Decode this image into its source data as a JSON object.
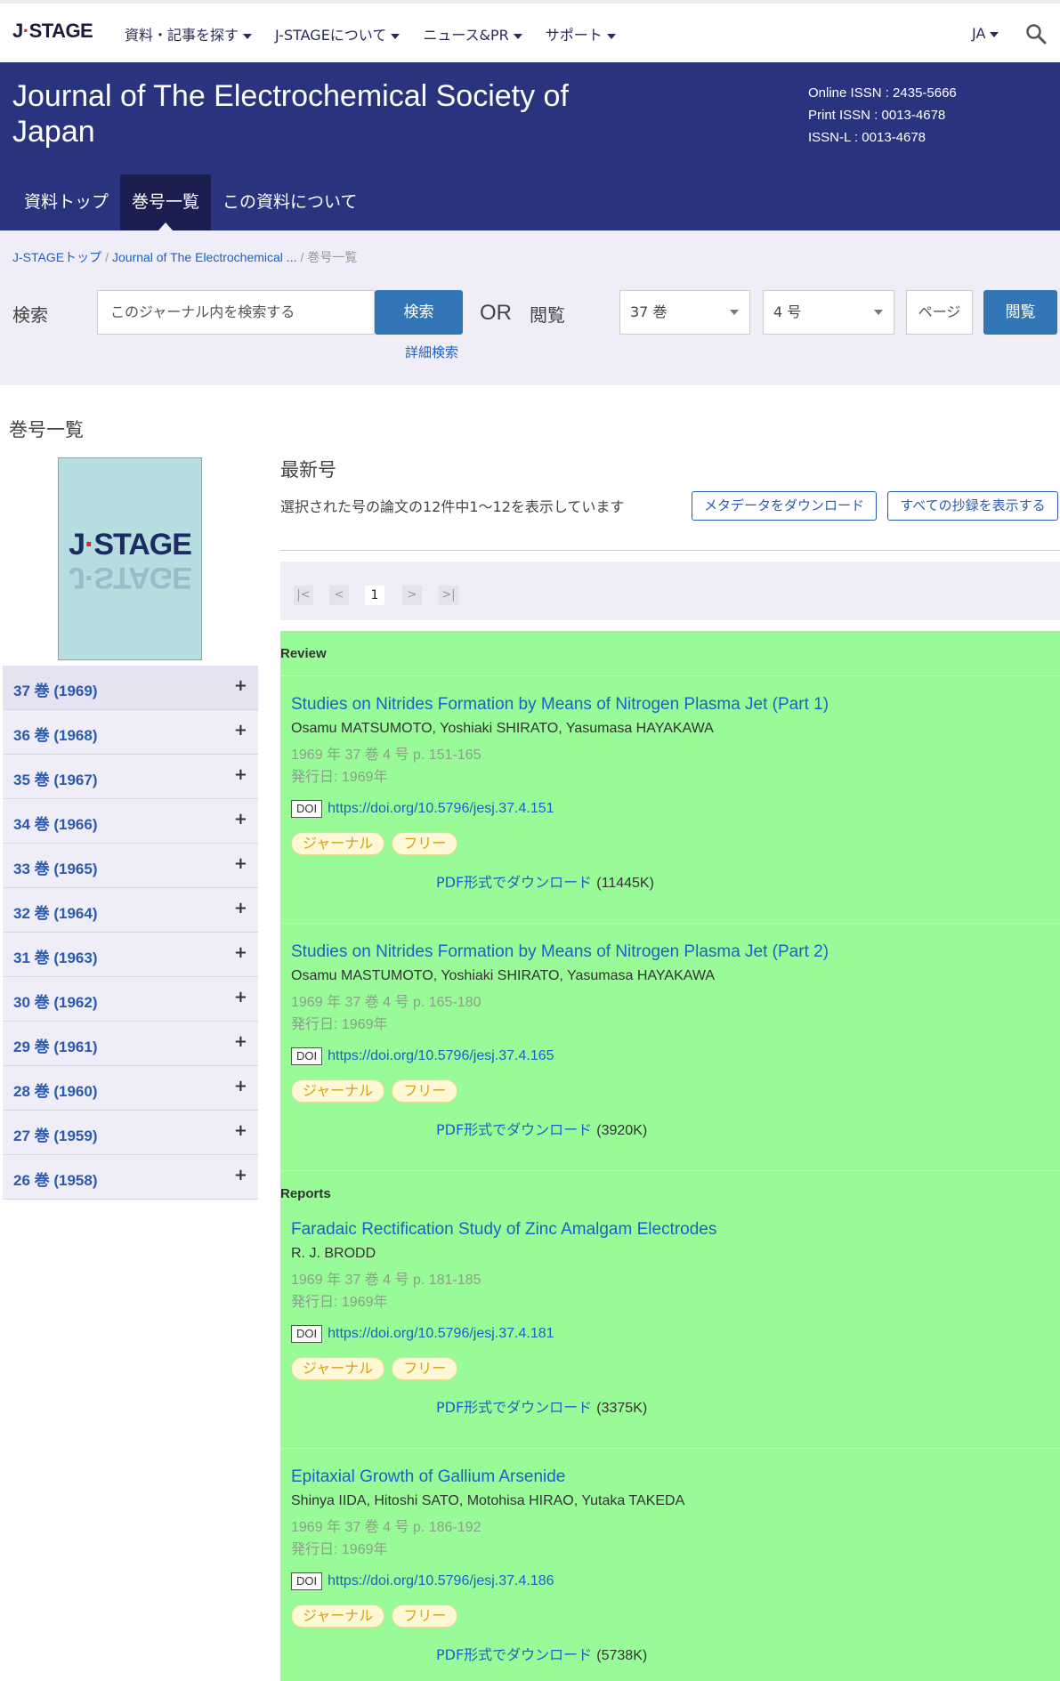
{
  "nav": {
    "logo": "J-STAGE",
    "items": [
      "資料・記事を探す",
      "J-STAGEについて",
      "ニュース&PR",
      "サポート"
    ],
    "lang": "JA"
  },
  "journal": {
    "title": "Journal of The Electrochemical Society of Japan",
    "issn_online": "Online ISSN : 2435-5666",
    "issn_print": "Print ISSN : 0013-4678",
    "issn_l": "ISSN-L : 0013-4678",
    "tabs": [
      "資料トップ",
      "巻号一覧",
      "この資料について"
    ]
  },
  "breadcrumb": {
    "home": "J-STAGEトップ",
    "journal": "Journal of The Electrochemical ...",
    "current": "巻号一覧"
  },
  "search": {
    "label": "検索",
    "placeholder": "このジャーナル内を検索する",
    "button": "検索",
    "advanced": "詳細検索",
    "or": "OR",
    "browse_label": "閲覧",
    "volume": "37 巻",
    "issue": "4 号",
    "page_placeholder": "ページ",
    "browse_button": "閲覧"
  },
  "sidebar": {
    "title": "巻号一覧",
    "cover_logo": "J-STAGE",
    "volumes": [
      "37 巻 (1969)",
      "36 巻 (1968)",
      "35 巻 (1967)",
      "34 巻 (1966)",
      "33 巻 (1965)",
      "32 巻 (1964)",
      "31 巻 (1963)",
      "30 巻 (1962)",
      "29 巻 (1961)",
      "28 巻 (1960)",
      "27 巻 (1959)",
      "26 巻 (1958)"
    ],
    "expand_symbol": "+"
  },
  "main": {
    "heading": "最新号",
    "showing": "選択された号の論文の12件中1～12を表示しています",
    "download_metadata": "メタデータをダウンロード",
    "show_all_abstracts": "すべての抄録を表示する",
    "pager": [
      "|<",
      "<",
      "1",
      ">",
      ">|"
    ],
    "doi_badge": "DOI",
    "tag_journal": "ジャーナル",
    "tag_free": "フリー",
    "pdf_label": "PDF形式でダウンロード",
    "categories": [
      "Review",
      "Reports"
    ],
    "articles": [
      {
        "title": "Studies on Nitrides Formation by Means of Nitrogen Plasma Jet (Part 1)",
        "authors": "Osamu MATSUMOTO, Yoshiaki SHIRATO, Yasumasa HAYAKAWA",
        "citation": "1969 年 37 巻 4 号 p. 151-165",
        "published": "発行日: 1969年",
        "doi": "https://doi.org/10.5796/jesj.37.4.151",
        "pdf_size": "(11445K)"
      },
      {
        "title": "Studies on Nitrides Formation by Means of Nitrogen Plasma Jet (Part 2)",
        "authors": "Osamu MASTUMOTO, Yoshiaki SHIRATO, Yasumasa HAYAKAWA",
        "citation": "1969 年 37 巻 4 号 p. 165-180",
        "published": "発行日: 1969年",
        "doi": "https://doi.org/10.5796/jesj.37.4.165",
        "pdf_size": "(3920K)"
      },
      {
        "title": "Faradaic Rectification Study of Zinc Amalgam Electrodes",
        "authors": "R. J. BRODD",
        "citation": "1969 年 37 巻 4 号 p. 181-185",
        "published": "発行日: 1969年",
        "doi": "https://doi.org/10.5796/jesj.37.4.181",
        "pdf_size": "(3375K)"
      },
      {
        "title": "Epitaxial Growth of Gallium Arsenide",
        "authors": "Shinya IIDA, Hitoshi SATO, Motohisa HIRAO, Yutaka TAKEDA",
        "citation": "1969 年 37 巻 4 号 p. 186-192",
        "published": "発行日: 1969年",
        "doi": "https://doi.org/10.5796/jesj.37.4.186",
        "pdf_size": "(5738K)"
      }
    ]
  }
}
